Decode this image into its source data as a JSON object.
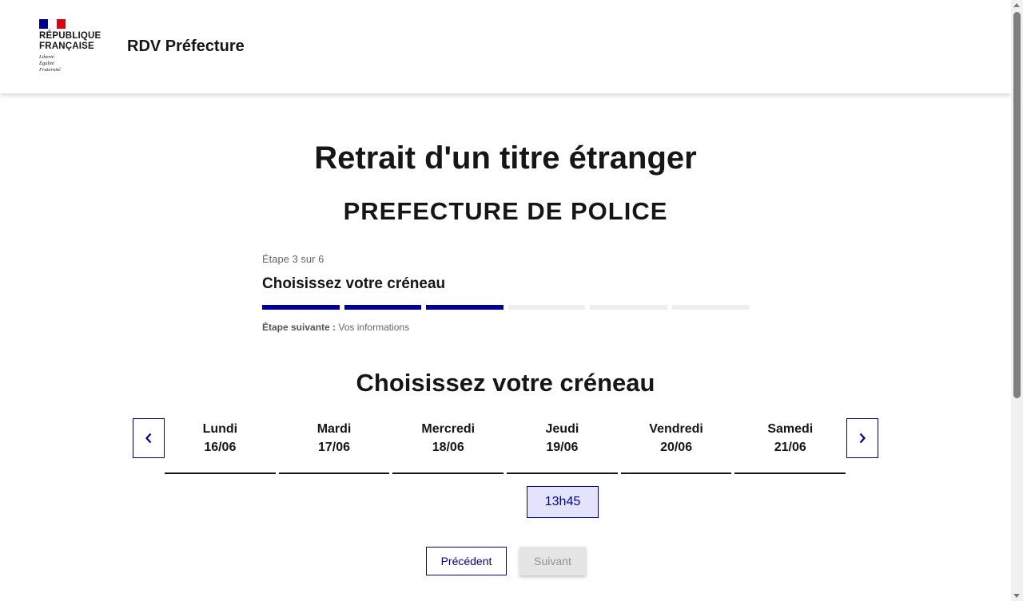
{
  "header": {
    "logo": {
      "name_line1": "RÉPUBLIQUE",
      "name_line2": "FRANÇAISE",
      "motto_line1": "Liberté",
      "motto_line2": "Égalité",
      "motto_line3": "Fraternité",
      "flag_colors": [
        "#000091",
        "#ffffff",
        "#e1000f"
      ]
    },
    "service_title": "RDV Préfecture"
  },
  "main": {
    "page_title": "Retrait d'un titre étranger",
    "prefecture": "PREFECTURE DE POLICE",
    "stepper": {
      "state": "Étape 3 sur 6",
      "current_step": "Choisissez votre créneau",
      "current": 3,
      "total": 6,
      "next_label": "Étape suivante :",
      "next_step": "Vos informations"
    },
    "section_title": "Choisissez votre créneau",
    "calendar": {
      "prev_icon": "chevron-left-icon",
      "next_icon": "chevron-right-icon",
      "days": [
        {
          "name": "Lundi",
          "date": "16/06"
        },
        {
          "name": "Mardi",
          "date": "17/06"
        },
        {
          "name": "Mercredi",
          "date": "18/06"
        },
        {
          "name": "Jeudi",
          "date": "19/06"
        },
        {
          "name": "Vendredi",
          "date": "20/06"
        },
        {
          "name": "Samedi",
          "date": "21/06"
        }
      ],
      "slot": "13h45"
    },
    "buttons": {
      "previous": "Précédent",
      "next": "Suivant"
    }
  },
  "colors": {
    "accent": "#000091",
    "slot_bg": "#e3e3fd",
    "disabled_bg": "#e5e5e5",
    "disabled_text": "#929292"
  }
}
